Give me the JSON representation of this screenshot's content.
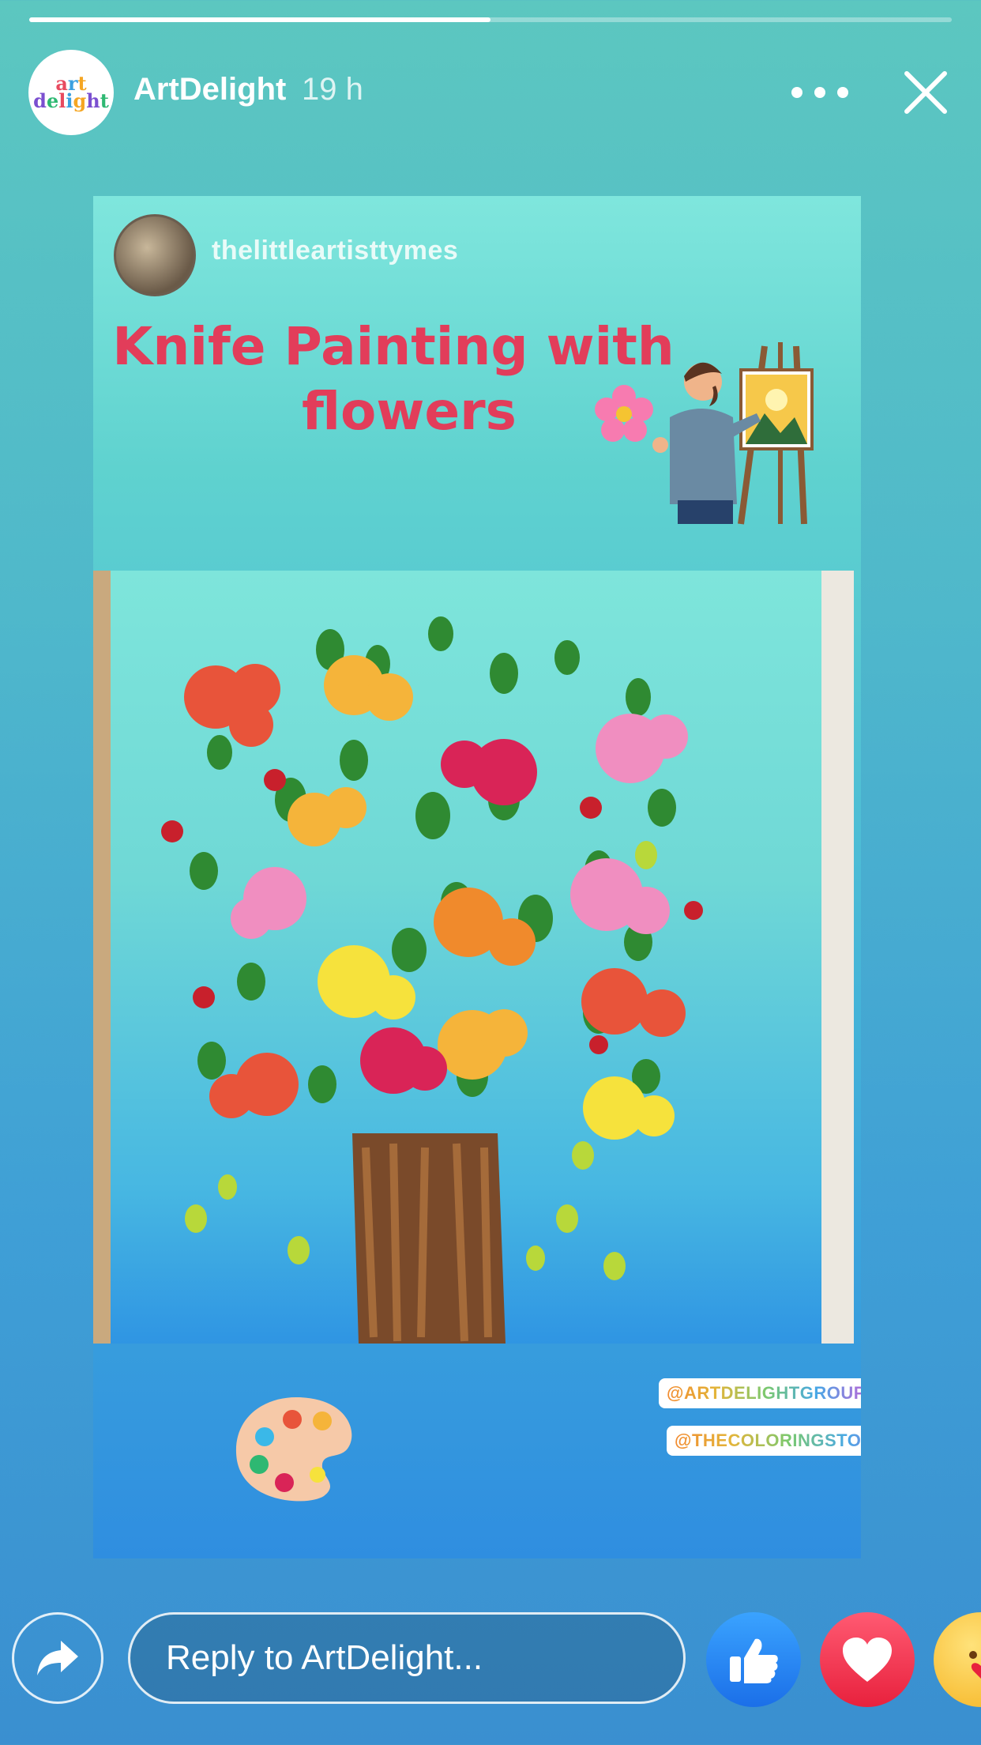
{
  "story": {
    "progress": 0.5,
    "author": "ArtDelight",
    "time": "19 h",
    "logo": {
      "line1": [
        "a",
        "r",
        "t"
      ],
      "line2": [
        "d",
        "e",
        "l",
        "i",
        "g",
        "h",
        "t"
      ]
    }
  },
  "card": {
    "username": "thelittleartisttymes",
    "title_line1": "Knife Painting with",
    "title_line2": "flowers",
    "tag1": "@ARTDELIGHTGROUP",
    "tag2": "@THECOLORINGSTORIES"
  },
  "reply": {
    "placeholder": "Reply to ArtDelight..."
  },
  "icons": {
    "more": "more-dots-icon",
    "close": "close-icon",
    "share": "share-arrow-icon",
    "like": "thumbs-up-icon",
    "love": "heart-icon",
    "care": "care-emoji-icon"
  },
  "colors": {
    "like": "#1b6fe8",
    "love": "#e8213d",
    "title": "#e23d5a"
  }
}
